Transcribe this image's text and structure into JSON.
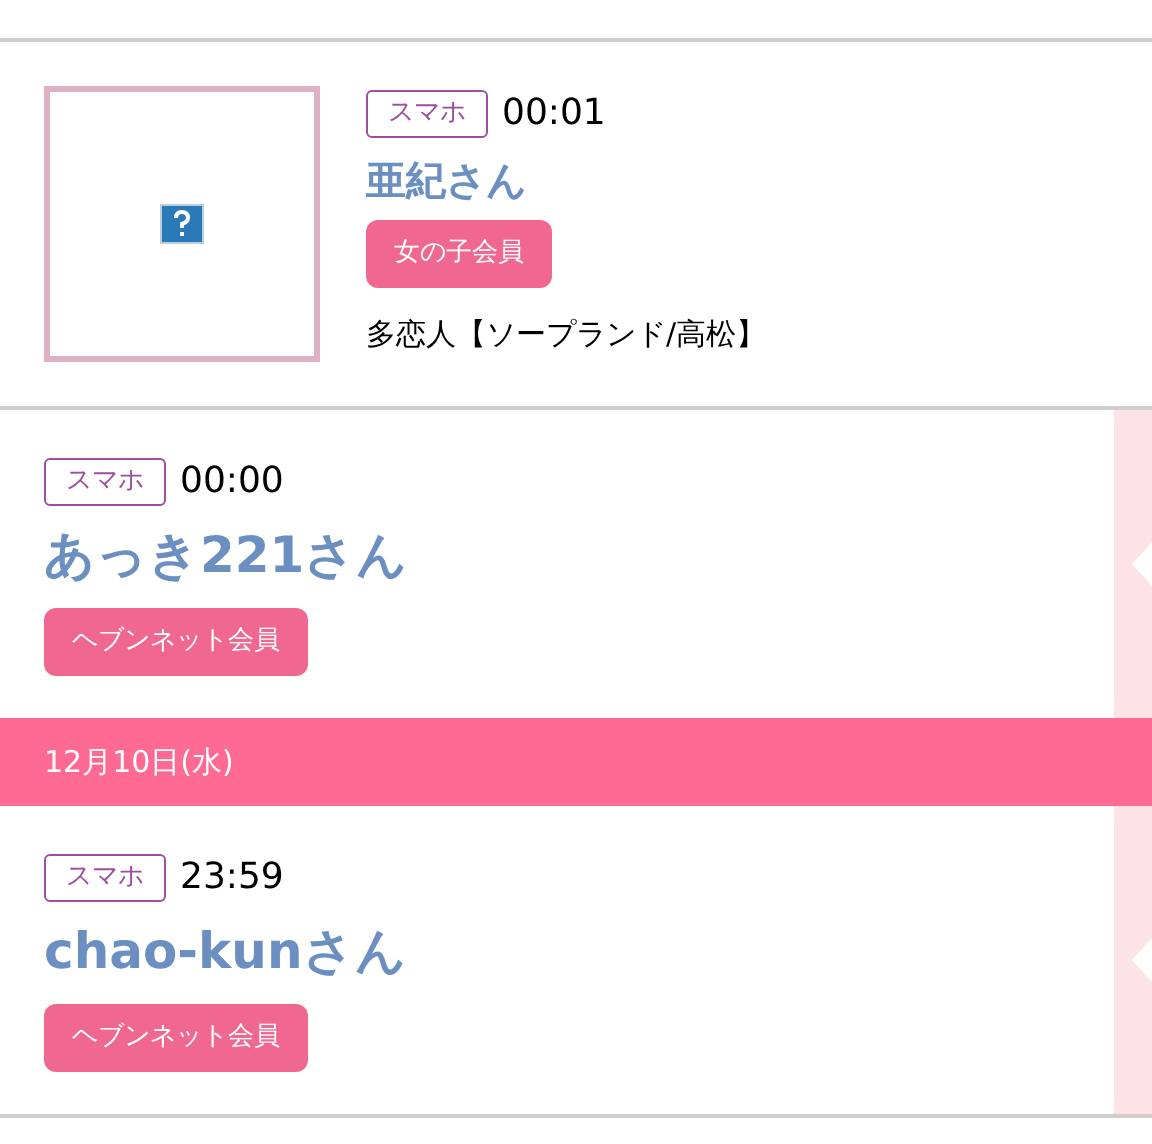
{
  "entries": [
    {
      "kind": "photo",
      "device": "スマホ",
      "time": "00:01",
      "name": "亜紀さん",
      "member": "女の子会員",
      "shop": "多恋人【ソープランド/高松】"
    },
    {
      "kind": "plain",
      "device": "スマホ",
      "time": "00:00",
      "name": "あっき221さん",
      "member": "ヘブンネット会員"
    },
    {
      "kind": "date",
      "label": "12月10日(水)"
    },
    {
      "kind": "plain",
      "device": "スマホ",
      "time": "23:59",
      "name": "chao-kunさん",
      "member": "ヘブンネット会員"
    }
  ]
}
